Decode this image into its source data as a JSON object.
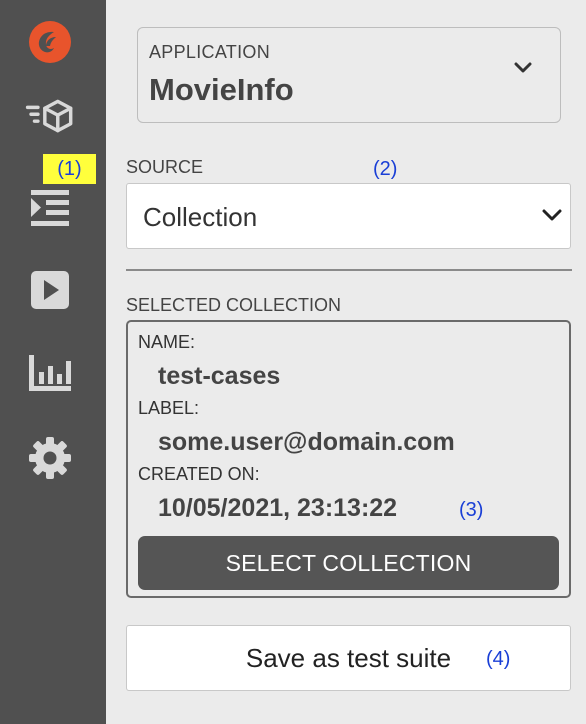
{
  "sidebar": {
    "items": [
      {
        "icon": "logo-icon"
      },
      {
        "icon": "cube-speed-icon"
      },
      {
        "icon": "indent-list-icon"
      },
      {
        "icon": "play-icon"
      },
      {
        "icon": "bar-chart-icon"
      },
      {
        "icon": "gear-icon"
      }
    ],
    "accent_color": "#e8542c"
  },
  "application": {
    "label": "APPLICATION",
    "value": "MovieInfo"
  },
  "source": {
    "label": "SOURCE",
    "value": "Collection"
  },
  "selected_collection": {
    "label": "SELECTED COLLECTION",
    "name_label": "NAME:",
    "name_value": "test-cases",
    "label_label": "LABEL:",
    "label_value": "some.user@domain.com",
    "created_label": "CREATED ON:",
    "created_value": "10/05/2021, 23:13:22",
    "select_button": "SELECT COLLECTION"
  },
  "save_button": "Save as test suite",
  "annotations": {
    "a1": "(1)",
    "a2": "(2)",
    "a3": "(3)",
    "a4": "(4)"
  }
}
